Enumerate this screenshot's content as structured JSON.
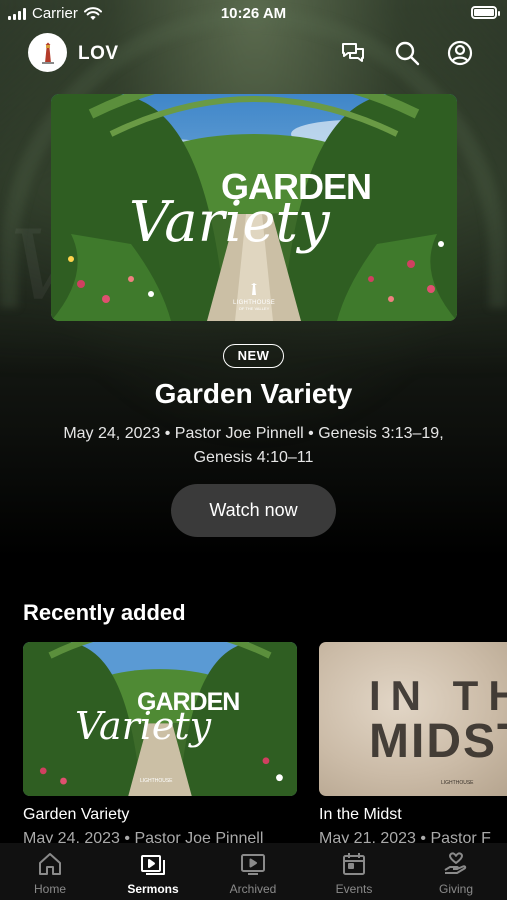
{
  "status_bar": {
    "carrier": "Carrier",
    "time": "10:26 AM"
  },
  "header": {
    "brand": "LOV"
  },
  "hero": {
    "badge": "NEW",
    "title": "Garden Variety",
    "meta": "May 24, 2023 • Pastor Joe Pinnell • Genesis 3:13–19, Genesis 4:10–11",
    "watch_label": "Watch now",
    "art_word1": "GARDEN",
    "art_word2": "Variety",
    "art_logo": "LIGHTHOUSE",
    "art_logo_sub": "OF THE VALLEY"
  },
  "recently_added": {
    "title": "Recently added",
    "items": [
      {
        "title": "Garden Variety",
        "meta": "May 24, 2023 • Pastor Joe Pinnell",
        "art_word1": "GARDEN",
        "art_word2": "Variety",
        "art_logo": "LIGHTHOUSE"
      },
      {
        "title": "In the Midst",
        "meta": "May 21, 2023 • Pastor F",
        "art_word1": "IN THE",
        "art_word2": "MIDST",
        "art_logo": "LIGHTHOUSE"
      }
    ]
  },
  "tabs": [
    {
      "label": "Home",
      "icon": "home-icon",
      "active": false
    },
    {
      "label": "Sermons",
      "icon": "sermons-icon",
      "active": true
    },
    {
      "label": "Archived",
      "icon": "archived-icon",
      "active": false
    },
    {
      "label": "Events",
      "icon": "calendar-icon",
      "active": false
    },
    {
      "label": "Giving",
      "icon": "giving-icon",
      "active": false
    }
  ],
  "colors": {
    "button_bg": "#3a3a3a",
    "tab_inactive": "#8a8a8a",
    "tab_active": "#ffffff"
  }
}
